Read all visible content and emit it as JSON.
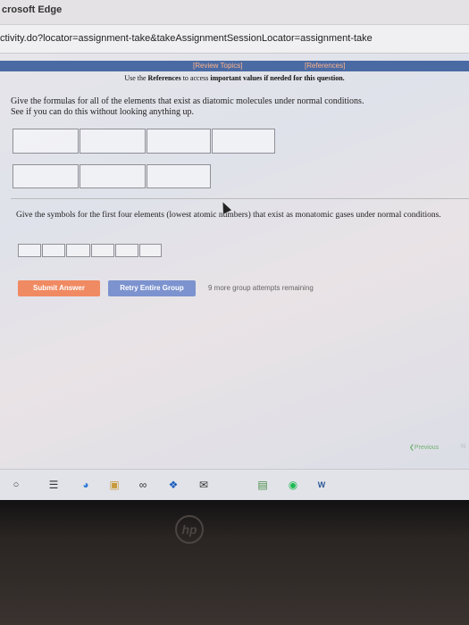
{
  "window": {
    "title": "crosoft Edge",
    "address": "ctivity.do?locator=assignment-take&takeAssignmentSessionLocator=assignment-take"
  },
  "toolbar": {
    "review_topics": "[Review Topics]",
    "references": "[References]"
  },
  "instruction": {
    "prefix": "Use the ",
    "bold1": "References",
    "middle": " to access ",
    "bold2": "important values if needed for this question."
  },
  "question1": {
    "text": "Give the formulas for all of the elements that exist as diatomic molecules under normal conditions.",
    "subtext": "See if you can do this without looking anything up."
  },
  "question2": {
    "text": "Give the symbols for the first four elements (lowest atomic numbers) that exist as monatomic gases under normal conditions."
  },
  "buttons": {
    "submit": "Submit Answer",
    "retry": "Retry Entire Group"
  },
  "attempts": "9 more group attempts remaining",
  "navigation": {
    "previous": "Previous",
    "next": "N"
  },
  "brand": "hp",
  "colors": {
    "ref_strip": "#4a6aa3",
    "submit": "#f08a62",
    "retry": "#7d93cf"
  },
  "taskbar_icons": [
    "circle-search-icon",
    "task-view-icon",
    "edge-icon",
    "store-icon",
    "people-icon",
    "dropbox-icon",
    "mail-icon",
    "notes-icon",
    "spotify-icon",
    "word-icon"
  ]
}
